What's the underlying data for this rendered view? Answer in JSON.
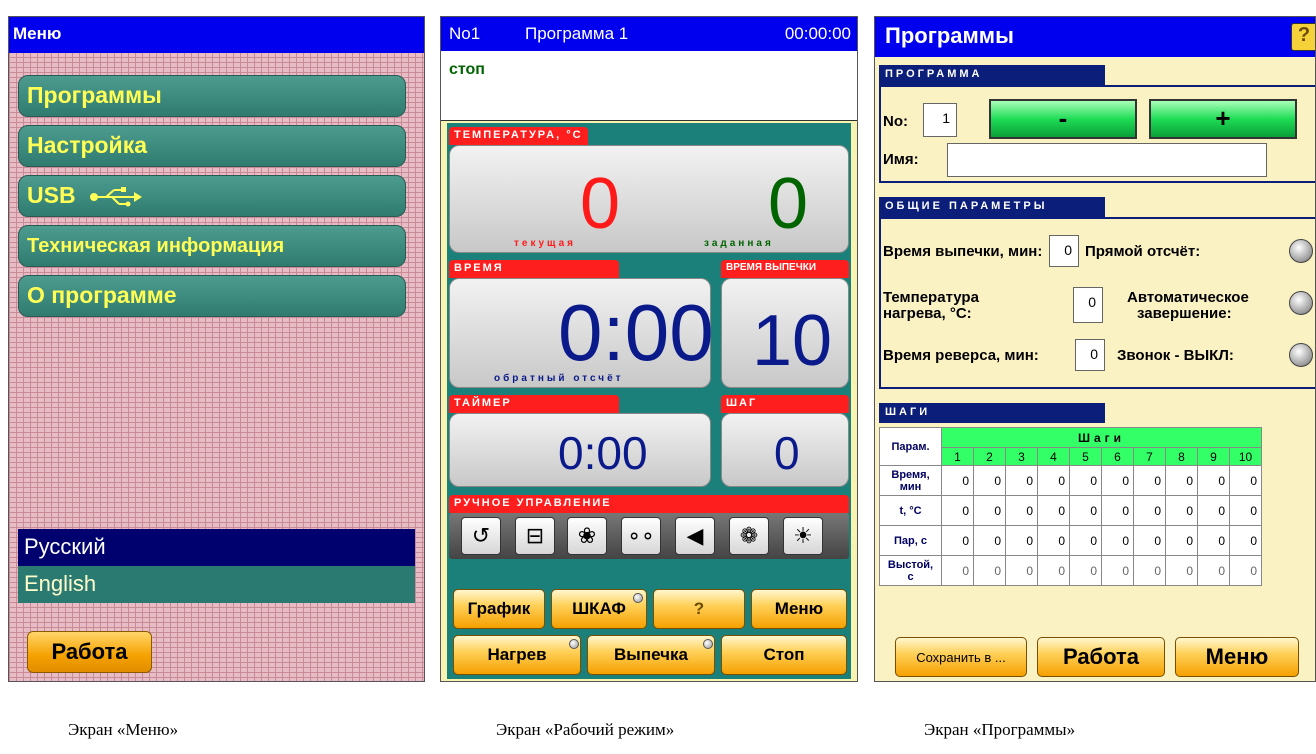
{
  "menu_screen": {
    "title": "Меню",
    "items": [
      "Программы",
      "Настройка",
      "USB",
      "Техническая информация",
      "О программе"
    ],
    "languages": [
      "Русский",
      "English"
    ],
    "work_button": "Работа",
    "caption": "Экран «Меню»"
  },
  "work_screen": {
    "header": {
      "number": "No1",
      "program": "Программа 1",
      "time": "00:00:00"
    },
    "status": "стоп",
    "temperature": {
      "tag": "ТЕМПЕРАТУРА, °C",
      "current": "0",
      "current_label": "текущая",
      "target": "0",
      "target_label": "заданная"
    },
    "time": {
      "tag": "ВРЕМЯ",
      "value": "0:00",
      "label": "обратный отсчёт"
    },
    "bake_time": {
      "tag": "ВРЕМЯ ВЫПЕЧКИ",
      "value": "10"
    },
    "timer": {
      "tag": "ТАЙМЕР",
      "value": "0:00"
    },
    "step": {
      "tag": "ШАГ",
      "value": "0"
    },
    "manual": {
      "tag": "РУЧНОЕ УПРАВЛЕНИЕ",
      "icons": [
        "reverse-icon",
        "door-icon",
        "fan-icon",
        "steam-icon",
        "sound-icon",
        "hood-fan-icon",
        "light-icon"
      ]
    },
    "buttons_row1": [
      "График",
      "ШКАФ",
      "?",
      "Меню"
    ],
    "buttons_row2": [
      "Нагрев",
      "Выпечка",
      "Стоп"
    ],
    "caption": "Экран «Рабочий режим»"
  },
  "programs_screen": {
    "title": "Программы",
    "program_section": "ПРОГРАММА",
    "no_label": "No:",
    "no_value": "1",
    "minus": "-",
    "plus": "+",
    "name_label": "Имя:",
    "name_value": "",
    "general_section": "ОБЩИЕ ПАРАМЕТРЫ",
    "bake_time_label": "Время выпечки, мин:",
    "bake_time_value": "0",
    "heat_temp_label1": "Температура",
    "heat_temp_label2": "нагрева, °C:",
    "heat_temp_value": "0",
    "reverse_label": "Время реверса, мин:",
    "reverse_value": "0",
    "direct_count_label": "Прямой отсчёт:",
    "auto_finish_label1": "Автоматическое",
    "auto_finish_label2": "завершение:",
    "bell_label": "Звонок - ВЫКЛ:",
    "steps_section": "ШАГИ",
    "steps_table": {
      "param_header": "Парам.",
      "steps_header": "Шаги",
      "step_numbers": [
        "1",
        "2",
        "3",
        "4",
        "5",
        "6",
        "7",
        "8",
        "9",
        "10"
      ],
      "rows": [
        {
          "label1": "Время,",
          "label2": "мин",
          "values": [
            "0",
            "0",
            "0",
            "0",
            "0",
            "0",
            "0",
            "0",
            "0",
            "0"
          ]
        },
        {
          "label1": "t, °C",
          "label2": "",
          "values": [
            "0",
            "0",
            "0",
            "0",
            "0",
            "0",
            "0",
            "0",
            "0",
            "0"
          ]
        },
        {
          "label1": "Пар, с",
          "label2": "",
          "values": [
            "0",
            "0",
            "0",
            "0",
            "0",
            "0",
            "0",
            "0",
            "0",
            "0"
          ]
        },
        {
          "label1": "Выстой,",
          "label2": "с",
          "values": [
            "0",
            "0",
            "0",
            "0",
            "0",
            "0",
            "0",
            "0",
            "0",
            "0"
          ]
        }
      ]
    },
    "save_button": "Сохранить в ...",
    "work_button": "Работа",
    "menu_button": "Меню",
    "caption": "Экран «Программы»"
  },
  "colors": {
    "title_blue": "#0000ee",
    "accent_teal": "#1b7f7a",
    "alarm_red": "#ff1e1e",
    "go_green": "#1fdc56",
    "button_orange": "#f5a000"
  }
}
